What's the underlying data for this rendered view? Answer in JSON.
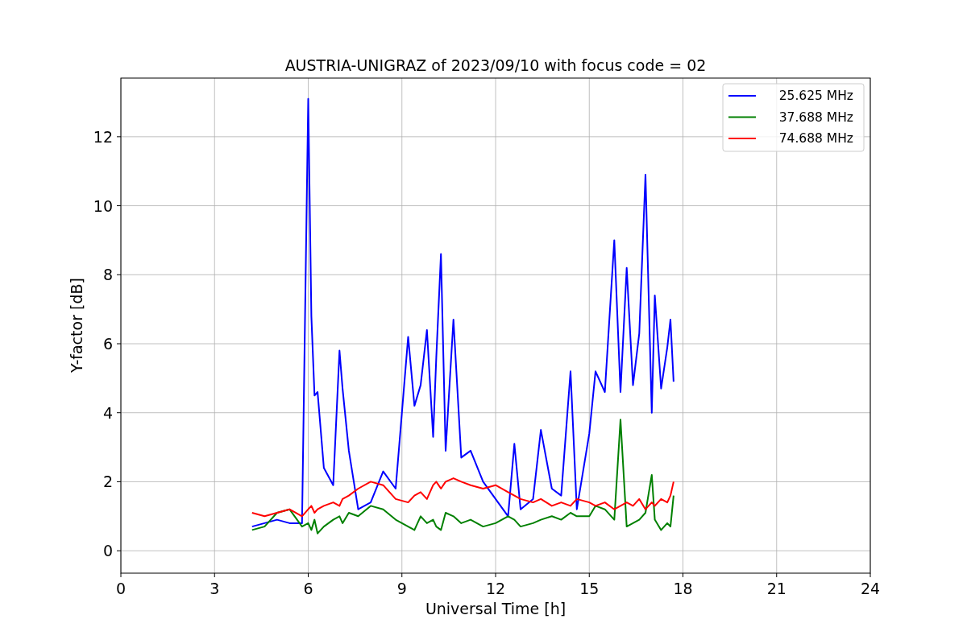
{
  "figure": {
    "chart_data": {
      "type": "line",
      "title": "AUSTRIA-UNIGRAZ of 2023/09/10 with focus code = 02",
      "xlabel": "Universal Time [h]",
      "ylabel": "Y-factor [dB]",
      "x": [
        4.2,
        4.6,
        5.0,
        5.4,
        5.8,
        6.0,
        6.1,
        6.2,
        6.3,
        6.5,
        6.8,
        7.0,
        7.1,
        7.3,
        7.6,
        8.0,
        8.4,
        8.8,
        9.2,
        9.4,
        9.6,
        9.8,
        10.0,
        10.1,
        10.25,
        10.4,
        10.65,
        10.9,
        11.2,
        11.6,
        12.0,
        12.4,
        12.6,
        12.8,
        13.2,
        13.45,
        13.8,
        14.1,
        14.4,
        14.6,
        15.0,
        15.2,
        15.5,
        15.8,
        16.0,
        16.2,
        16.4,
        16.6,
        16.8,
        17.0,
        17.1,
        17.3,
        17.5,
        17.6,
        17.7
      ],
      "series": [
        {
          "name": "25.625 MHz",
          "color": "#0000ff",
          "values": [
            0.7,
            0.8,
            0.9,
            0.8,
            0.8,
            13.1,
            6.8,
            4.5,
            4.6,
            2.4,
            1.9,
            5.8,
            4.7,
            2.9,
            1.2,
            1.4,
            2.3,
            1.8,
            6.2,
            4.2,
            4.8,
            6.4,
            3.3,
            5.6,
            8.6,
            2.9,
            6.7,
            2.7,
            2.9,
            2.0,
            1.5,
            1.0,
            3.1,
            1.2,
            1.5,
            3.5,
            1.8,
            1.6,
            5.2,
            1.2,
            3.4,
            5.2,
            4.6,
            9.0,
            4.6,
            8.2,
            4.8,
            6.3,
            10.9,
            4.0,
            7.4,
            4.7,
            5.9,
            6.7,
            4.9
          ]
        },
        {
          "name": "37.688 MHz",
          "color": "#008000",
          "values": [
            0.6,
            0.7,
            1.1,
            1.2,
            0.7,
            0.8,
            0.6,
            0.9,
            0.5,
            0.7,
            0.9,
            1.0,
            0.8,
            1.1,
            1.0,
            1.3,
            1.2,
            0.9,
            0.7,
            0.6,
            1.0,
            0.8,
            0.9,
            0.7,
            0.6,
            1.1,
            1.0,
            0.8,
            0.9,
            0.7,
            0.8,
            1.0,
            0.9,
            0.7,
            0.8,
            0.9,
            1.0,
            0.9,
            1.1,
            1.0,
            1.0,
            1.3,
            1.2,
            0.9,
            3.8,
            0.7,
            0.8,
            0.9,
            1.1,
            2.2,
            0.9,
            0.6,
            0.8,
            0.7,
            1.6
          ]
        },
        {
          "name": "74.688 MHz",
          "color": "#ff0000",
          "values": [
            1.1,
            1.0,
            1.1,
            1.2,
            1.0,
            1.2,
            1.3,
            1.1,
            1.2,
            1.3,
            1.4,
            1.3,
            1.5,
            1.6,
            1.8,
            2.0,
            1.9,
            1.5,
            1.4,
            1.6,
            1.7,
            1.5,
            1.9,
            2.0,
            1.8,
            2.0,
            2.1,
            2.0,
            1.9,
            1.8,
            1.9,
            1.7,
            1.6,
            1.5,
            1.4,
            1.5,
            1.3,
            1.4,
            1.3,
            1.5,
            1.4,
            1.3,
            1.4,
            1.2,
            1.3,
            1.4,
            1.3,
            1.5,
            1.2,
            1.4,
            1.3,
            1.5,
            1.4,
            1.6,
            2.0
          ]
        }
      ],
      "grid": true,
      "legend": true,
      "xlim": [
        0,
        24
      ],
      "ylim": [
        -0.65,
        13.7
      ],
      "xticks": [
        0,
        3,
        6,
        9,
        12,
        15,
        18,
        21,
        24
      ],
      "yticks": [
        0,
        2,
        4,
        6,
        8,
        10,
        12
      ]
    }
  }
}
